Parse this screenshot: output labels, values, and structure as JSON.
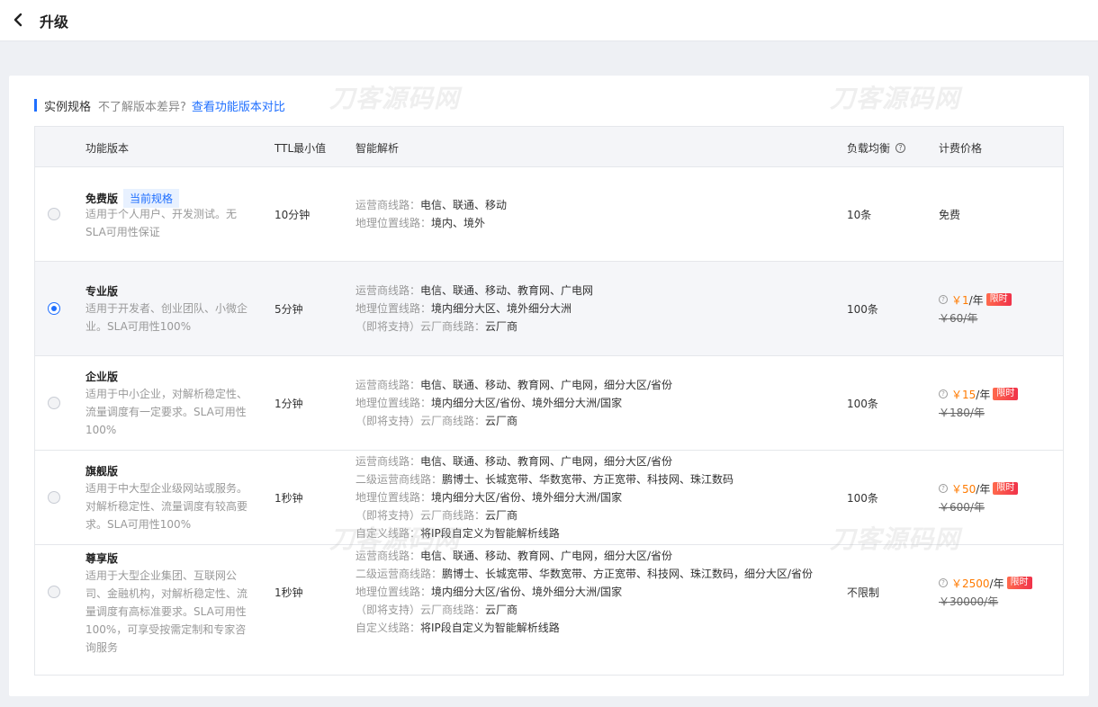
{
  "header": {
    "title": "升级",
    "back_icon": "chevron-left-icon"
  },
  "spec": {
    "title": "实例规格",
    "question": "不了解版本差异?",
    "compare_link": "查看功能版本对比"
  },
  "watermark": "刀客源码网",
  "columns": {
    "version": "功能版本",
    "ttl": "TTL最小值",
    "smart": "智能解析",
    "lb": "负载均衡",
    "price": "计费价格"
  },
  "rows": [
    {
      "name": "免费版",
      "tag": "当前规格",
      "desc": "适用于个人用户、开发测试。无SLA可用性保证",
      "ttl": "10分钟",
      "lines": [
        {
          "k": "运营商线路：",
          "v": "电信、联通、移动"
        },
        {
          "k": "地理位置线路：",
          "v": "境内、境外"
        }
      ],
      "lb": "10条",
      "price_free": "免费",
      "selected": false
    },
    {
      "name": "专业版",
      "desc": "适用于开发者、创业团队、小微企业。SLA可用性100%",
      "ttl": "5分钟",
      "lines": [
        {
          "k": "运营商线路：",
          "v": "电信、联通、移动、教育网、广电网"
        },
        {
          "k": "地理位置线路：",
          "v": "境内细分大区、境外细分大洲"
        },
        {
          "k": "（即将支持）云厂商线路：",
          "v": "云厂商"
        }
      ],
      "lb": "100条",
      "price_now": "￥1",
      "price_unit": "/年",
      "promo": "限时",
      "price_old": "￥60/年",
      "selected": true
    },
    {
      "name": "企业版",
      "desc": "适用于中小企业，对解析稳定性、流量调度有一定要求。SLA可用性100%",
      "ttl": "1分钟",
      "lines": [
        {
          "k": "运营商线路：",
          "v": "电信、联通、移动、教育网、广电网，细分大区/省份"
        },
        {
          "k": "地理位置线路：",
          "v": "境内细分大区/省份、境外细分大洲/国家"
        },
        {
          "k": "（即将支持）云厂商线路：",
          "v": "云厂商"
        }
      ],
      "lb": "100条",
      "price_now": "￥15",
      "price_unit": "/年",
      "promo": "限时",
      "price_old": "￥180/年",
      "selected": false
    },
    {
      "name": "旗舰版",
      "desc": "适用于中大型企业级网站或服务。对解析稳定性、流量调度有较高要求。SLA可用性100%",
      "ttl": "1秒钟",
      "lines": [
        {
          "k": "运营商线路：",
          "v": "电信、联通、移动、教育网、广电网，细分大区/省份"
        },
        {
          "k": "二级运营商线路：",
          "v": "鹏博士、长城宽带、华数宽带、方正宽带、科技网、珠江数码"
        },
        {
          "k": "地理位置线路：",
          "v": "境内细分大区/省份、境外细分大洲/国家"
        },
        {
          "k": "（即将支持）云厂商线路：",
          "v": "云厂商"
        },
        {
          "k": "自定义线路：",
          "v": "将IP段自定义为智能解析线路"
        }
      ],
      "lb": "100条",
      "price_now": "￥50",
      "price_unit": "/年",
      "promo": "限时",
      "price_old": "￥600/年",
      "selected": false
    },
    {
      "name": "尊享版",
      "desc": "适用于大型企业集团、互联网公司、金融机构，对解析稳定性、流量调度有高标准要求。SLA可用性100%，可享受按需定制和专家咨询服务",
      "ttl": "1秒钟",
      "lines": [
        {
          "k": "运营商线路：",
          "v": "电信、联通、移动、教育网、广电网，细分大区/省份"
        },
        {
          "k": "二级运营商线路：",
          "v": "鹏博士、长城宽带、华数宽带、方正宽带、科技网、珠江数码，细分大区/省份"
        },
        {
          "k": "地理位置线路：",
          "v": "境内细分大区/省份、境外细分大洲/国家"
        },
        {
          "k": "（即将支持）云厂商线路：",
          "v": "云厂商"
        },
        {
          "k": "自定义线路：",
          "v": "将IP段自定义为智能解析线路"
        }
      ],
      "lb": "不限制",
      "price_now": "￥2500",
      "price_unit": "/年",
      "promo": "限时",
      "price_old": "￥30000/年",
      "selected": false
    }
  ]
}
